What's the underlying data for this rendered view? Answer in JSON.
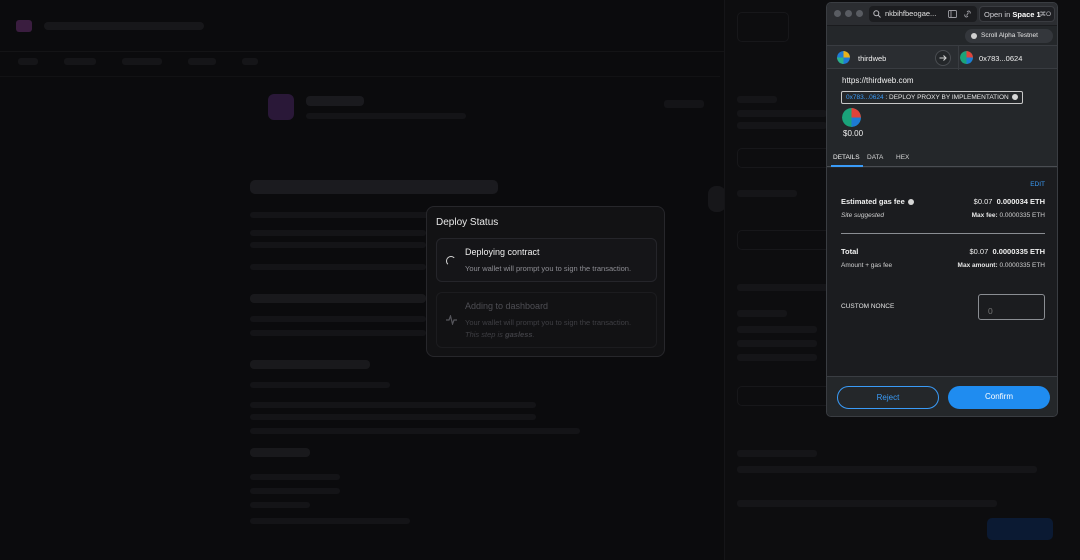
{
  "deploy_modal": {
    "title": "Deploy Status",
    "steps": [
      {
        "title": "Deploying contract",
        "description": "Your wallet will prompt you to sign the transaction.",
        "state": "in-progress"
      },
      {
        "title": "Adding to dashboard",
        "description": "Your wallet will prompt you to sign the transaction.",
        "note_prefix": "This step is ",
        "note_emphasis": "gasless",
        "note_suffix": ".",
        "state": "pending"
      }
    ]
  },
  "browser": {
    "url": "nkbihfbeogae...",
    "space_prefix": "Open in ",
    "space_name": "Space 1",
    "shortcut": "⌘O"
  },
  "wallet": {
    "network": "Scroll Alpha Testnet",
    "from_account": "thirdweb",
    "to_account": "0x783...0624",
    "origin": "https://thirdweb.com",
    "method_address": "0x783...0624",
    "method_label": " : DEPLOY PROXY BY IMPLEMENTATION",
    "value": "$0.00",
    "tabs": [
      "DETAILS",
      "DATA",
      "HEX"
    ],
    "active_tab": "DETAILS",
    "edit_label": "EDIT",
    "gas": {
      "label": "Estimated gas fee",
      "fiat": "$0.07",
      "eth": "0.000034 ETH",
      "sub_label": "Site suggested",
      "max_label": "Max fee:",
      "max_value": "0.0000335 ETH"
    },
    "total": {
      "label": "Total",
      "fiat": "$0.07",
      "eth": "0.0000335 ETH",
      "sub_label": "Amount + gas fee",
      "max_label": "Max amount:",
      "max_value": "0.0000335 ETH"
    },
    "nonce": {
      "label": "CUSTOM NONCE",
      "placeholder": "0"
    },
    "reject_label": "Reject",
    "confirm_label": "Confirm"
  },
  "colors": {
    "accent": "#3a9bf7",
    "confirm": "#1f8cf0",
    "modal_bg": "#121214"
  }
}
